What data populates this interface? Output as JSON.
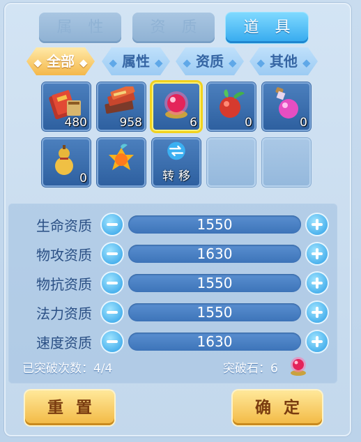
{
  "tabs": [
    {
      "label": "属 性"
    },
    {
      "label": "资 质"
    },
    {
      "label": "道 具"
    }
  ],
  "filters": [
    {
      "label": "全部"
    },
    {
      "label": "属性"
    },
    {
      "label": "资质"
    },
    {
      "label": "其他"
    }
  ],
  "items": [
    {
      "icon": "red-book-icon",
      "count": "480"
    },
    {
      "icon": "stacked-books-icon",
      "count": "958"
    },
    {
      "icon": "pink-gem-icon",
      "count": "6"
    },
    {
      "icon": "pomegranate-icon",
      "count": "0"
    },
    {
      "icon": "pink-potion-icon",
      "count": "0"
    },
    {
      "icon": "gourd-icon",
      "count": "0"
    },
    {
      "icon": "golden-fruit-icon",
      "count": ""
    },
    {
      "icon": "transfer-icon",
      "label": "转移"
    }
  ],
  "stats": [
    {
      "label": "生命资质",
      "value": "1550"
    },
    {
      "label": "物攻资质",
      "value": "1630"
    },
    {
      "label": "物抗资质",
      "value": "1550"
    },
    {
      "label": "法力资质",
      "value": "1550"
    },
    {
      "label": "速度资质",
      "value": "1630"
    }
  ],
  "footer": {
    "breaks_text": "已突破次数：4/4",
    "stone_text": "突破石：6"
  },
  "buttons": {
    "reset": "重置",
    "confirm": "确定"
  },
  "colors": {
    "active_tab": "#34a9ee",
    "active_chip": "#f4b84a",
    "stat_bar": "#3d74b9",
    "selected_slot": "#f2d21d"
  }
}
